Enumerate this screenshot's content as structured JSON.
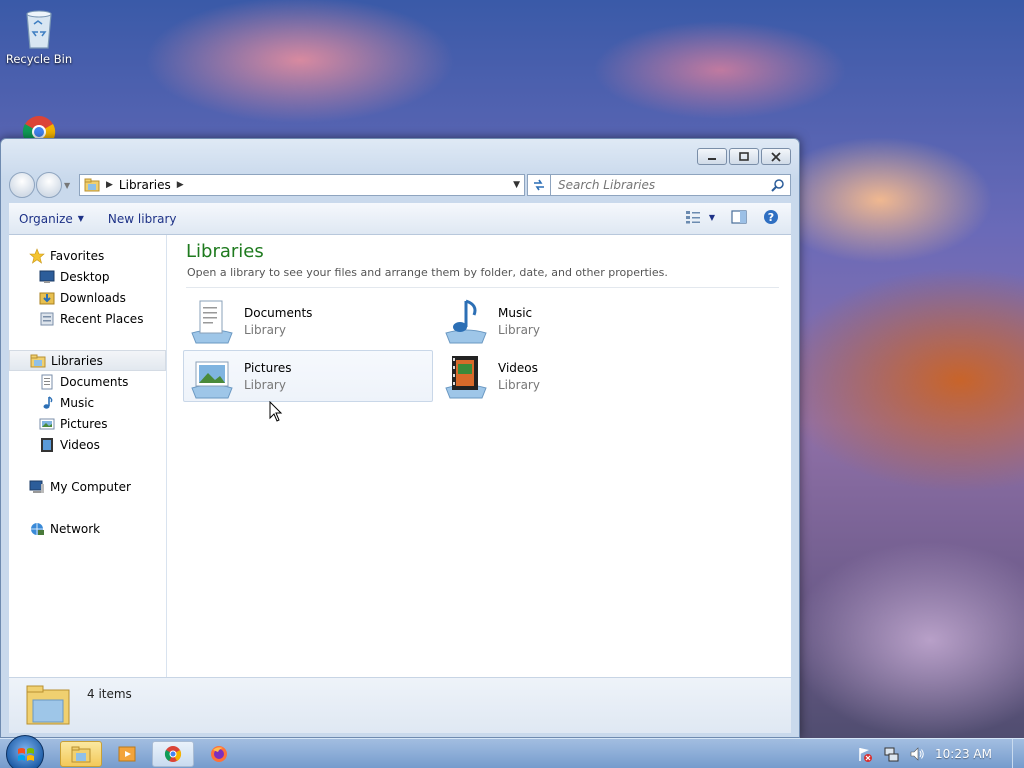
{
  "desktop": {
    "icons": [
      {
        "label": "Recycle Bin",
        "icon": "recycle-bin-icon"
      },
      {
        "label": "",
        "icon": "chrome-icon"
      }
    ]
  },
  "window": {
    "caption_buttons": [
      "minimize",
      "restore",
      "close"
    ],
    "address": {
      "crumbs": [
        "Libraries"
      ]
    },
    "search": {
      "placeholder": "Search Libraries"
    },
    "toolbar": {
      "organize_label": "Organize",
      "new_library_label": "New library"
    },
    "nav_pane": {
      "favorites": {
        "label": "Favorites",
        "items": [
          "Desktop",
          "Downloads",
          "Recent Places"
        ]
      },
      "libraries": {
        "label": "Libraries",
        "items": [
          "Documents",
          "Music",
          "Pictures",
          "Videos"
        ]
      },
      "computer": {
        "label": "My Computer"
      },
      "network": {
        "label": "Network"
      }
    },
    "main": {
      "title": "Libraries",
      "subtitle": "Open a library to see your files and arrange them by folder, date, and other properties.",
      "libraries": [
        {
          "name": "Documents",
          "kind": "Library",
          "icon": "documents-library-icon"
        },
        {
          "name": "Music",
          "kind": "Library",
          "icon": "music-library-icon"
        },
        {
          "name": "Pictures",
          "kind": "Library",
          "icon": "pictures-library-icon"
        },
        {
          "name": "Videos",
          "kind": "Library",
          "icon": "videos-library-icon"
        }
      ]
    },
    "details": {
      "count": "4 items"
    }
  },
  "taskbar": {
    "tasks": [
      "file-explorer",
      "media-player",
      "chrome",
      "firefox"
    ],
    "clock": "10:23 AM"
  },
  "colors": {
    "title_green": "#1e7a1e",
    "link_blue": "#1e3287",
    "highlight": "#eef3fa"
  }
}
